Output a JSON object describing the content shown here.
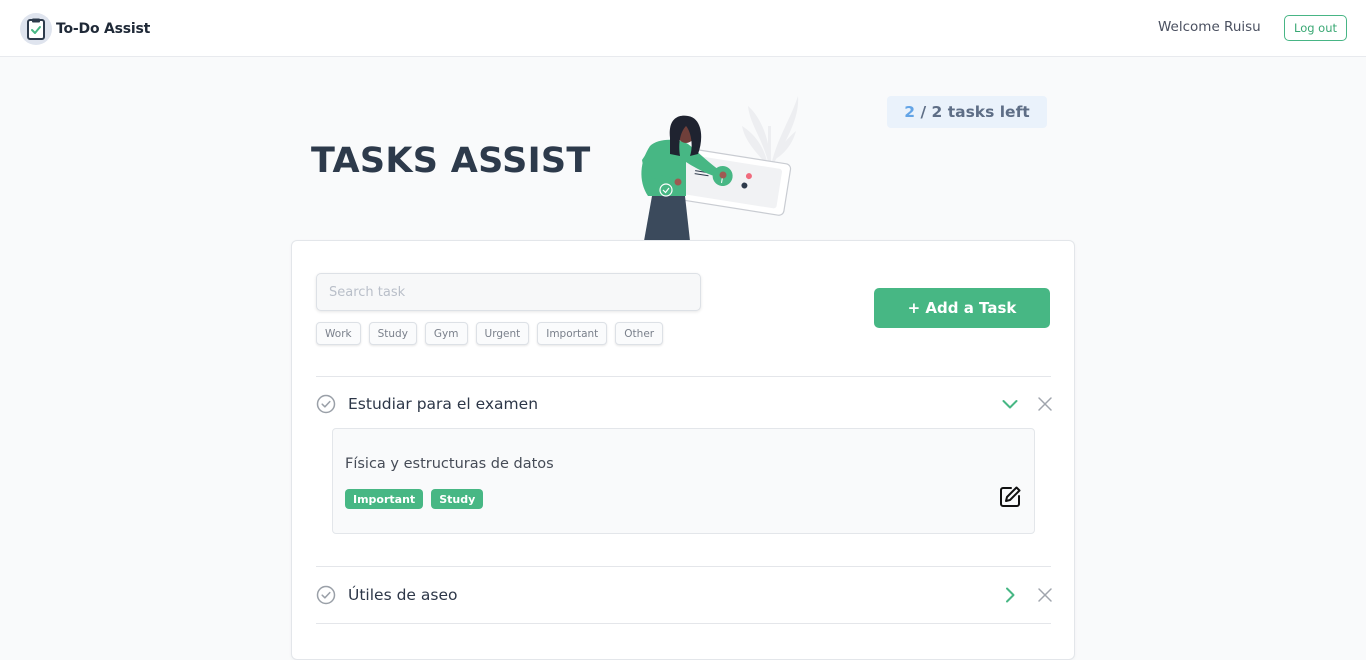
{
  "navbar": {
    "brand": "To-Do Assist",
    "welcome": "Welcome Ruisu",
    "logout_label": "Log out"
  },
  "hero": {
    "title": "TASKS ASSIST",
    "tasks_left_count": "2",
    "tasks_left_rest": " / 2 tasks left"
  },
  "search": {
    "placeholder": "Search task"
  },
  "filters": [
    "Work",
    "Study",
    "Gym",
    "Urgent",
    "Important",
    "Other"
  ],
  "add_task_label": "+ Add a Task",
  "tasks": [
    {
      "title": "Estudiar para el examen",
      "expanded": true,
      "description": "Física y estructuras de datos",
      "tags": [
        "Important",
        "Study"
      ]
    },
    {
      "title": "Útiles de aseo",
      "expanded": false
    }
  ],
  "colors": {
    "accent": "#47b784",
    "tasks_left_bg": "#eaf2fb",
    "tasks_left_count": "#63a4e6",
    "title": "#2d3a4b"
  },
  "icons": {
    "brand": "clipboard-check-icon",
    "task_check": "circle-check-icon",
    "expand": "chevron-down-icon",
    "collapse": "chevron-right-icon",
    "remove": "close-icon",
    "edit": "edit-icon"
  }
}
